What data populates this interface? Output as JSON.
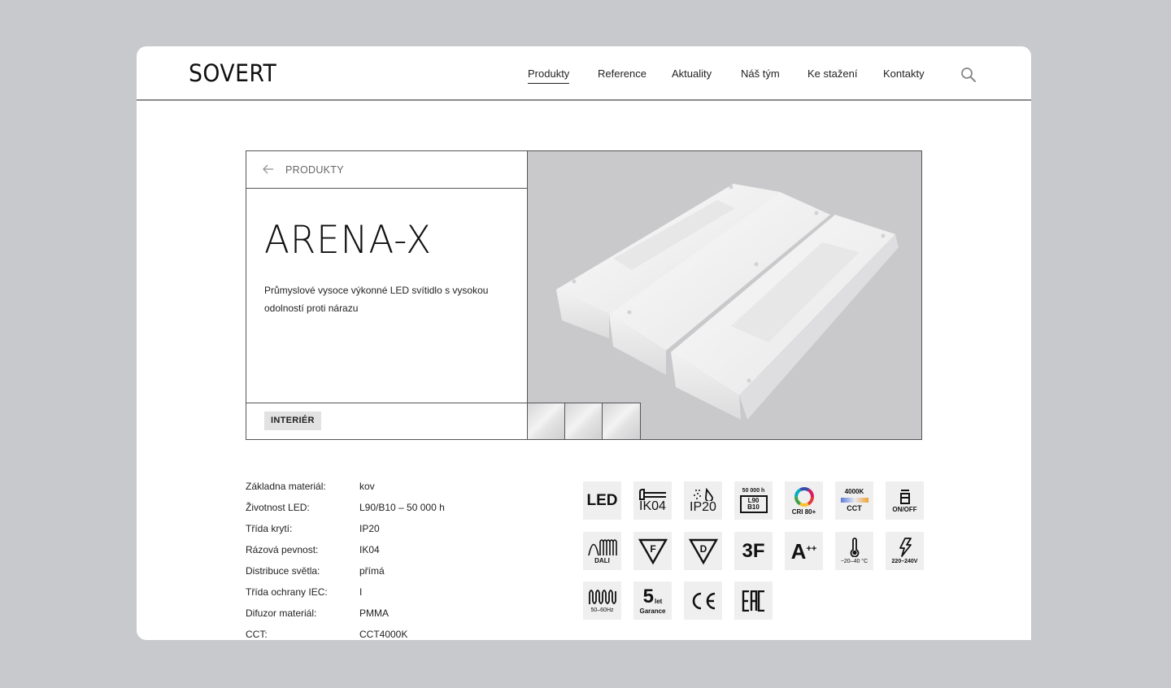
{
  "brand": {
    "logo": "SOVERT"
  },
  "nav": {
    "items": [
      {
        "label": "Produkty",
        "active": true
      },
      {
        "label": "Reference",
        "active": false
      },
      {
        "label": "Aktuality",
        "active": false
      },
      {
        "label": "Náš tým",
        "active": false
      },
      {
        "label": "Ke stažení",
        "active": false
      },
      {
        "label": "Kontakty",
        "active": false
      }
    ],
    "search_icon": "search-icon"
  },
  "product": {
    "back_label": "PRODUKTY",
    "back_icon": "arrow-left-icon",
    "name": "ARENA-X",
    "description": "Průmyslové vysoce výkonné LED svítidlo s vysokou odolností proti nárazu",
    "tag": "INTERIÉR",
    "thumbnails": 3,
    "image_alt": "ARENA-X LED luminaire render"
  },
  "specs": [
    {
      "label": "Základna materiál:",
      "value": "kov"
    },
    {
      "label": "Životnost LED:",
      "value": "L90/B10 – 50 000 h"
    },
    {
      "label": "Třída krytí:",
      "value": "IP20"
    },
    {
      "label": "Rázová pevnost:",
      "value": "IK04"
    },
    {
      "label": "Distribuce světla:",
      "value": "přímá"
    },
    {
      "label": "Třída ochrany IEC:",
      "value": "I"
    },
    {
      "label": "Difuzor materiál:",
      "value": "PMMA"
    },
    {
      "label": "CCT:",
      "value": "CCT4000K"
    }
  ],
  "badges": {
    "led": "LED",
    "ik": "IK04",
    "ip": "IP20",
    "life_top": "50 000 h",
    "life_l": "L90",
    "life_b": "B10",
    "cri": "CRI 80+",
    "cct_top": "4000K",
    "cct": "CCT",
    "onoff": "ON/OFF",
    "dali": "DALI",
    "f": "F",
    "d": "D",
    "threef": "3F",
    "energy": "A",
    "energy_sup": "++",
    "temp": "−20–40 °C",
    "voltage": "220–240V",
    "freq": "50–60Hz",
    "warranty_num": "5",
    "warranty_unit": "let",
    "warranty": "Garance",
    "ce": "CE",
    "eac": "EAC"
  },
  "colors": {
    "background": "#c8c9cc",
    "card": "#ffffff",
    "image_bg": "#c9c9cc",
    "badge_bg": "#efefef",
    "tag_bg": "#e2e2e2"
  }
}
